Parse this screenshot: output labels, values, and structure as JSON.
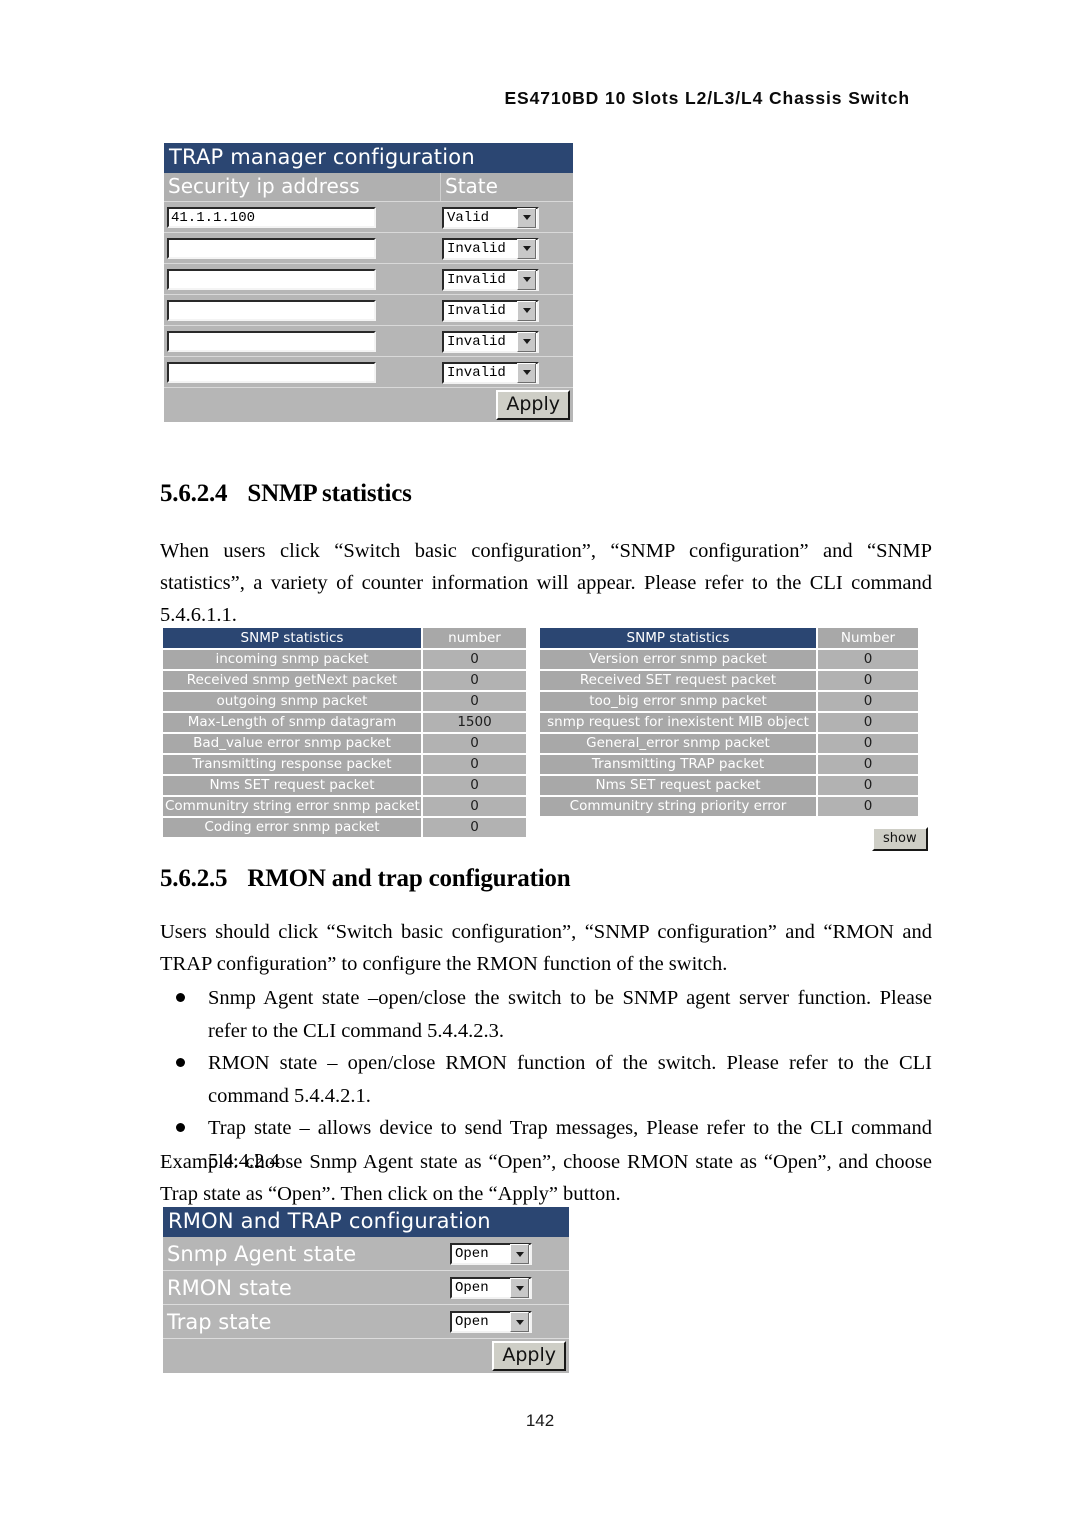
{
  "document": {
    "running_head": "ES4710BD 10 Slots L2/L3/L4 Chassis Switch",
    "page_number": "142"
  },
  "trap_manager": {
    "title": "TRAP manager configuration",
    "columns": {
      "ip": "Security ip address",
      "state": "State"
    },
    "rows": [
      {
        "ip": "41.1.1.100",
        "state": "Valid"
      },
      {
        "ip": "",
        "state": "Invalid"
      },
      {
        "ip": "",
        "state": "Invalid"
      },
      {
        "ip": "",
        "state": "Invalid"
      },
      {
        "ip": "",
        "state": "Invalid"
      },
      {
        "ip": "",
        "state": "Invalid"
      }
    ],
    "apply_label": "Apply"
  },
  "section_snmp_statistics": {
    "number": "5.6.2.4",
    "title": "SNMP statistics",
    "paragraph": "When users click “Switch basic configuration”, “SNMP configuration” and “SNMP statistics”, a variety of counter information will appear. Please refer to the CLI command 5.4.6.1.1."
  },
  "snmp_stats_left": {
    "header": {
      "name": "SNMP statistics",
      "number": "number"
    },
    "rows": [
      {
        "name": "incoming snmp packet",
        "value": "0"
      },
      {
        "name": "Received snmp getNext packet",
        "value": "0"
      },
      {
        "name": "outgoing snmp packet",
        "value": "0"
      },
      {
        "name": "Max-Length of snmp datagram",
        "value": "1500"
      },
      {
        "name": "Bad_value error snmp packet",
        "value": "0"
      },
      {
        "name": "Transmitting response packet",
        "value": "0"
      },
      {
        "name": "Nms SET request packet",
        "value": "0"
      },
      {
        "name": "Communitry string error snmp packet",
        "value": "0"
      },
      {
        "name": "Coding error snmp packet",
        "value": "0"
      }
    ]
  },
  "snmp_stats_right": {
    "header": {
      "name": "SNMP statistics",
      "number": "Number"
    },
    "rows": [
      {
        "name": "Version error snmp packet",
        "value": "0"
      },
      {
        "name": "Received SET request packet",
        "value": "0"
      },
      {
        "name": "too_big error snmp packet",
        "value": "0"
      },
      {
        "name": "snmp request for inexistent MIB object",
        "value": "0"
      },
      {
        "name": "General_error snmp packet",
        "value": "0"
      },
      {
        "name": "Transmitting TRAP packet",
        "value": "0"
      },
      {
        "name": "Nms SET request packet",
        "value": "0"
      },
      {
        "name": "Communitry string priority error",
        "value": "0"
      }
    ],
    "show_label": "show"
  },
  "section_rmon": {
    "number": "5.6.2.5",
    "title": "RMON and trap configuration",
    "paragraph": "Users should click “Switch basic configuration”, “SNMP configuration” and “RMON and TRAP configuration” to configure the RMON function of the switch.",
    "bullets": [
      "Snmp Agent state –open/close the switch to be SNMP agent server function. Please refer to the CLI command 5.4.4.2.3.",
      "RMON state – open/close RMON function of the switch. Please refer to the CLI command 5.4.4.2.1.",
      "Trap state – allows device to send Trap messages, Please refer to the CLI command 5.4.4.2.4"
    ],
    "example": "Example: choose Snmp Agent state as “Open”, choose RMON state as “Open”, and choose Trap state as “Open”. Then click on the “Apply” button."
  },
  "rmon_panel": {
    "title": "RMON and TRAP configuration",
    "rows": [
      {
        "label": "Snmp Agent state",
        "value": "Open"
      },
      {
        "label": "RMON state",
        "value": "Open"
      },
      {
        "label": "Trap state",
        "value": "Open"
      }
    ],
    "apply_label": "Apply"
  },
  "colors": {
    "panel_title_bg": "#2b4672",
    "panel_row_bg": "#b6b6b6",
    "subheader_bg": "#b0b0b0",
    "stat_row_bg": "#a8a8a8",
    "stat_num_bg": "#b2b2b2",
    "button_bg": "#cecec6"
  }
}
